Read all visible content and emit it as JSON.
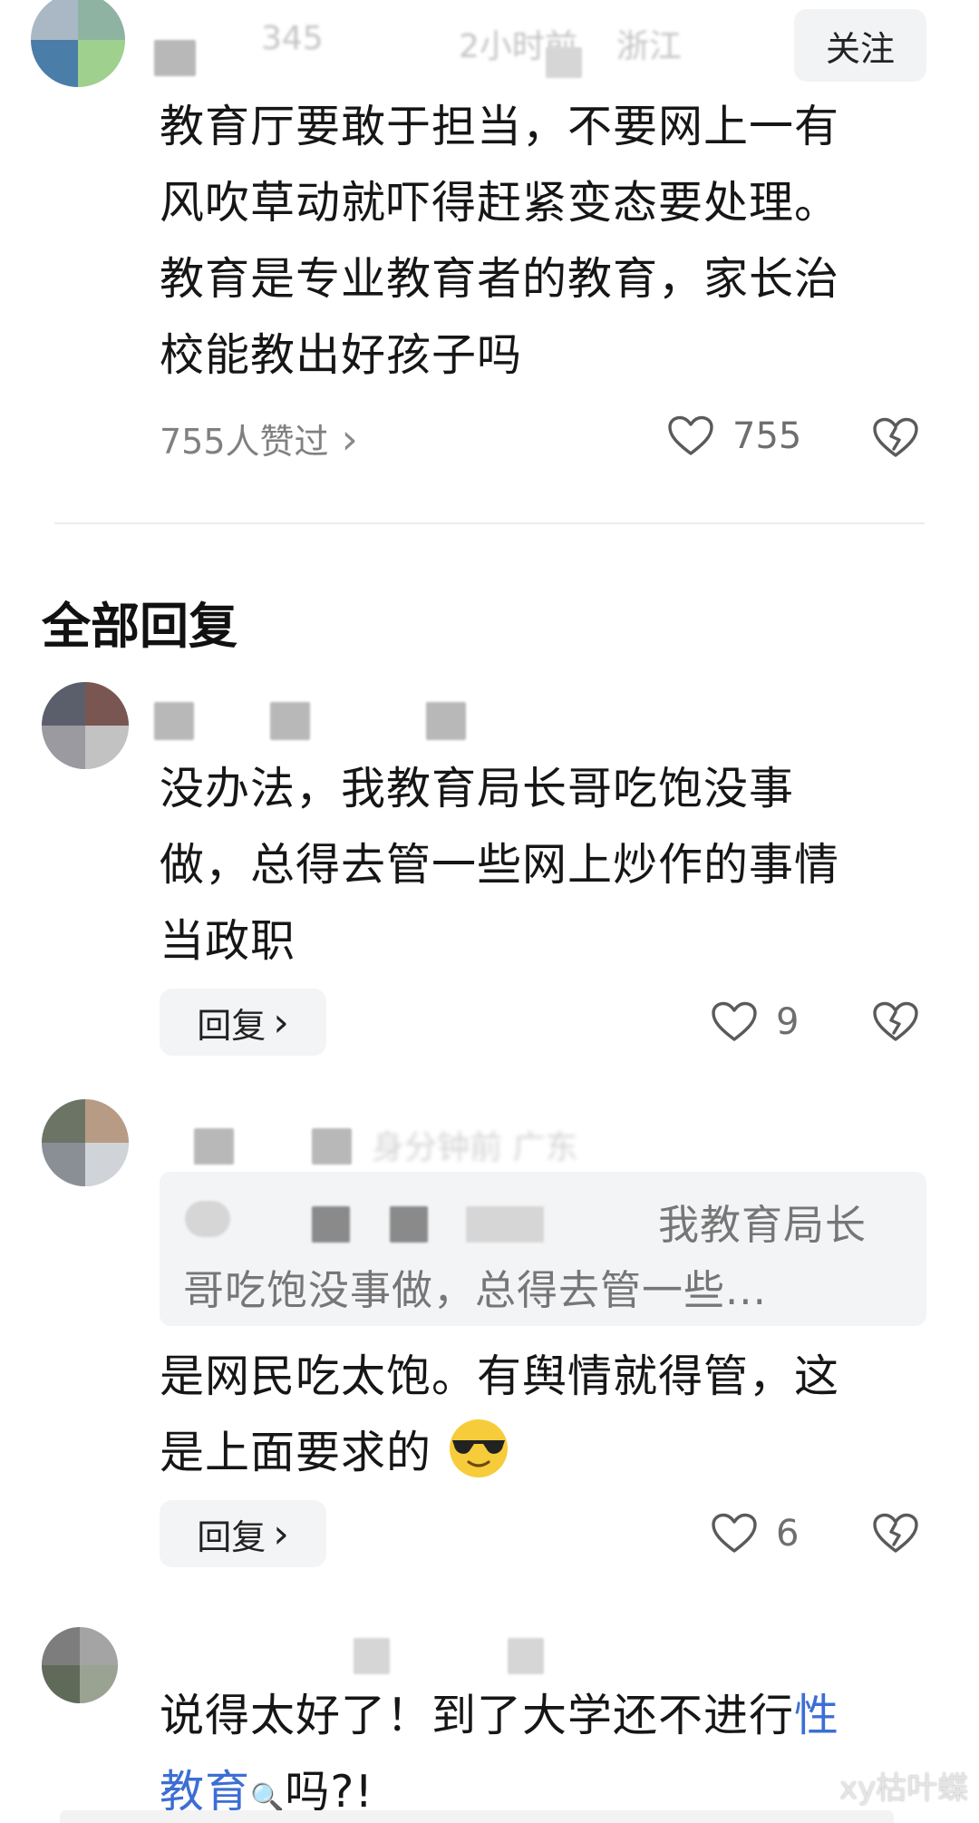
{
  "top_comment": {
    "meta_time": "2小时前",
    "meta_location": "浙江",
    "username_fragment": "345",
    "follow_label": "关注",
    "lines": [
      "教育厅要敢于担当，不要网上一有",
      "风吹草动就吓得赶紧变态要处理。",
      "教育是专业教育者的教育，家长治",
      "校能教出好孩子吗"
    ],
    "likers_text": "755人赞过",
    "likers_chevron": "›",
    "like_count": "755",
    "like_icon": "heart-outline-icon",
    "dislike_icon": "broken-heart-icon"
  },
  "section_title": "全部回复",
  "replies": [
    {
      "lines": [
        "没办法，我教育局长哥吃饱没事",
        "做，总得去管一些网上炒作的事情",
        "当政职"
      ],
      "reply_label": "回复",
      "reply_chevron": "›",
      "like_count": "9"
    },
    {
      "meta_blurred": "身分钟前 广东",
      "quote_line1": "我教育局长",
      "quote_line2": "哥吃饱没事做，总得去管一些...",
      "line1": "是网民吃太饱。有舆情就得管，这",
      "line2": "是上面要求的",
      "emoji": "sunglasses-emoji",
      "reply_label": "回复",
      "reply_chevron": "›",
      "like_count": "6"
    },
    {
      "line1_plain": "说得太好了！到了大学还不进行",
      "line1_link": "性",
      "line2_link": "教育",
      "line2_search_icon": "🔍",
      "line2_plain": "吗?!"
    }
  ],
  "watermark": "xy枯叶蝶",
  "colors": {
    "text": "#161616",
    "muted": "#808080",
    "link": "#3c6fd4",
    "button_bg": "#f3f4f6",
    "divider": "#ececec"
  }
}
